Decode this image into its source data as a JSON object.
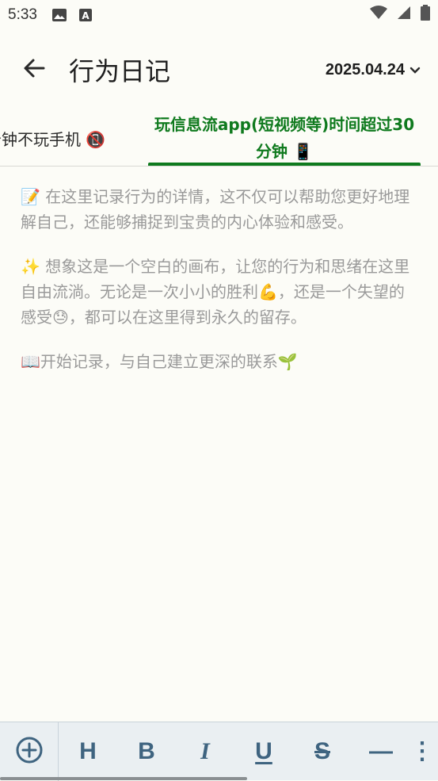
{
  "status_bar": {
    "time": "5:33",
    "icons_left": [
      "image-icon",
      "a-box-icon"
    ],
    "icons_right": [
      "wifi-icon",
      "signal-icon",
      "battery-icon"
    ]
  },
  "app_bar": {
    "back_icon": "arrow-left-icon",
    "title": "行为日记",
    "date": "2025.04.24",
    "date_dropdown_icon": "chevron-down-icon"
  },
  "tabs": [
    {
      "label": "分钟不玩手机 📵",
      "active": false
    },
    {
      "label": "玩信息流app(短视频等)时间超过30分钟 📱",
      "active": true
    }
  ],
  "editor": {
    "placeholder_paragraphs": [
      "📝 在这里记录行为的详情，这不仅可以帮助您更好地理解自己，还能够捕捉到宝贵的内心体验和感受。",
      "✨ 想象这是一个空白的画布，让您的行为和思绪在这里自由流淌。无论是一次小小的胜利💪，还是一个失望的感受😓，都可以在这里得到永久的留存。",
      "📖开始记录，与自己建立更深的联系🌱"
    ]
  },
  "toolbar": {
    "add_icon": "plus-circle-icon",
    "heading": "H",
    "bold": "B",
    "italic": "I",
    "underline": "U",
    "strike": "S",
    "divider": "—",
    "more": "⋮"
  },
  "colors": {
    "accent": "#0f7a1e",
    "toolbar_icon": "#3f6480",
    "placeholder_text": "#9a9a9a"
  }
}
